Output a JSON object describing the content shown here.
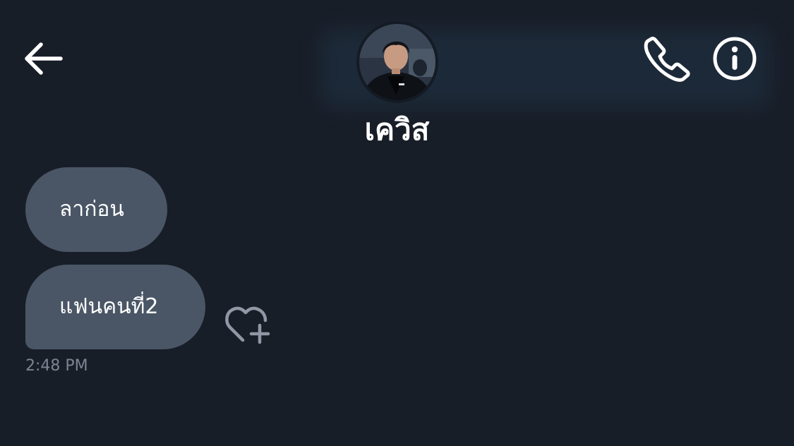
{
  "header": {
    "contact_name": "เควิส",
    "back_icon": "arrow-left-icon",
    "call_icon": "phone-icon",
    "info_icon": "info-circle-icon"
  },
  "messages": [
    {
      "text": "ลาก่อน",
      "sender": "contact"
    },
    {
      "text": "แฟนคนที่2",
      "sender": "contact"
    }
  ],
  "last_message_time": "2:48 PM",
  "reaction_icon": "heart-plus-icon",
  "colors": {
    "background": "#181e28",
    "bubble": "#4a5666",
    "timestamp": "#7b8593",
    "icon": "#ffffff"
  }
}
